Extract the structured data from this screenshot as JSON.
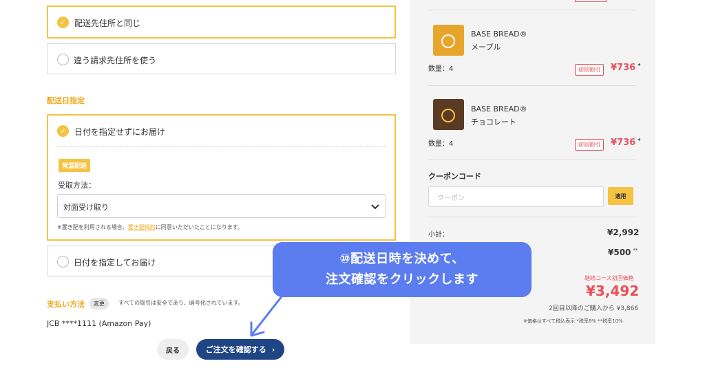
{
  "address": {
    "same_label": "配送先住所と同じ",
    "other_label": "違う請求先住所を使う"
  },
  "delivery": {
    "section_title": "配送日指定",
    "no_date_label": "日付を指定せずにお届け",
    "regular_tag": "常温配送",
    "receive_label": "受取方法：",
    "receive_value": "対面受け取り",
    "note_prefix": "※置き配を利用される場合、",
    "note_link": "置き配規約",
    "note_suffix": "に同意いただいたことになります。",
    "with_date_label": "日付を指定してお届け"
  },
  "payment": {
    "title": "支払い方法",
    "change_label": "変更",
    "secure_text": "すべての取引は安全であり、暗号化されています。",
    "card_text": "JCB ****1111 (Amazon Pay)"
  },
  "actions": {
    "back_label": "戻る",
    "confirm_label": "ご注文を確認する",
    "confirm_icon": "chevron-right"
  },
  "cart": {
    "items": [
      {
        "brand": "BASE BREAD®",
        "flavor": "メープル",
        "qty": "数量：4",
        "tag": "初回割引",
        "price": "¥736",
        "mark": "*",
        "color": "#e8a52c"
      },
      {
        "brand": "BASE BREAD®",
        "flavor": "チョコレート",
        "qty": "数量：4",
        "tag": "初回割引",
        "price": "¥736",
        "mark": "*",
        "color": "#5a3a22"
      }
    ],
    "coupon_title": "クーポンコード",
    "coupon_placeholder": "クーポン",
    "apply_label": "適用",
    "subtotal_label": "小計：",
    "subtotal_value": "¥2,992",
    "shipping_value": "¥500",
    "shipping_mark": "**",
    "course_label": "継続コース初回価格",
    "total_value": "¥3,492",
    "second_note": "2回目以降のご購入から ¥3,866",
    "tax_note": "※価格はすべて税込表示 *税率8% **税率10%"
  },
  "annotation": {
    "line1": "⑩配送日時を決めて、",
    "line2": "注文確認をクリックします"
  },
  "colors": {
    "accent": "#f5c341",
    "primary": "#1f4585",
    "discount": "#e8505b",
    "callout": "#5b7df0"
  }
}
